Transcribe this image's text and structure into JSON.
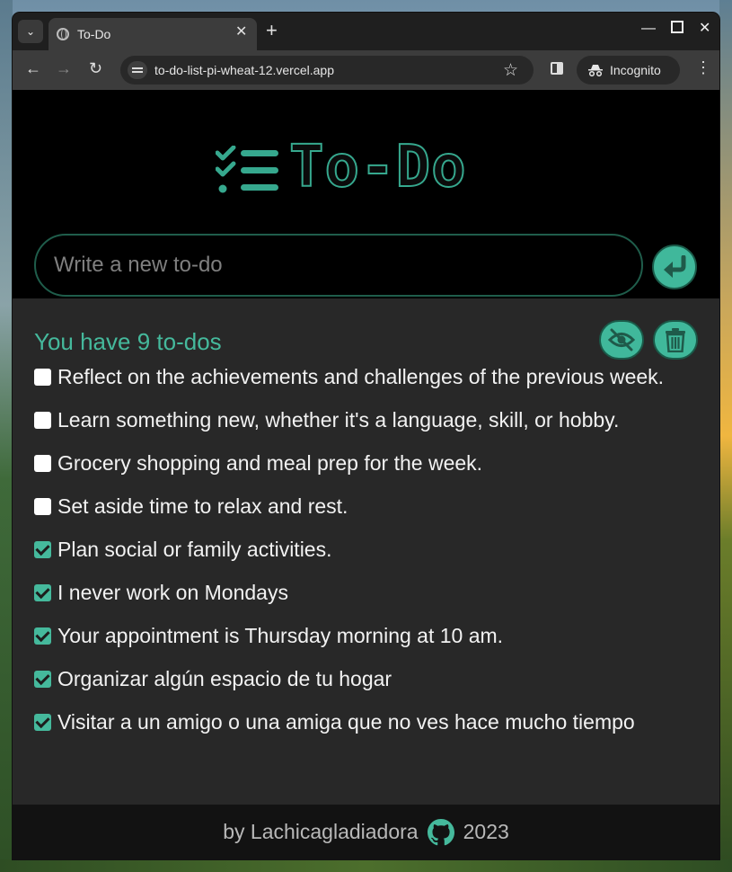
{
  "browser": {
    "tab_title": "To-Do",
    "url": "to-do-list-pi-wheat-12.vercel.app",
    "incognito_label": "Incognito",
    "new_tab_symbol": "+",
    "close_symbol": "✕"
  },
  "app": {
    "logo_text": "To-Do",
    "input_placeholder": "Write a new to-do",
    "count_text": "You have 9 to-dos",
    "accent_color": "#45b99c"
  },
  "todos": [
    {
      "text": "Reflect on the achievements and challenges of the previous week.",
      "done": false
    },
    {
      "text": "Learn something new, whether it's a language, skill, or hobby.",
      "done": false
    },
    {
      "text": "Grocery shopping and meal prep for the week.",
      "done": false
    },
    {
      "text": "Set aside time to relax and rest.",
      "done": false
    },
    {
      "text": "Plan social or family activities.",
      "done": true
    },
    {
      "text": "I never work on Mondays",
      "done": true
    },
    {
      "text": "Your appointment is Thursday morning at 10 am.",
      "done": true
    },
    {
      "text": "Organizar algún espacio de tu hogar",
      "done": true
    },
    {
      "text": "Visitar a un amigo o una amiga que no ves hace mucho tiempo",
      "done": true
    }
  ],
  "footer": {
    "by_text": "by Lachicagladiadora",
    "year": "2023"
  },
  "icons": {
    "submit": "enter-arrow-icon",
    "hide": "eye-slash-icon",
    "delete": "trash-icon",
    "github": "github-icon"
  }
}
